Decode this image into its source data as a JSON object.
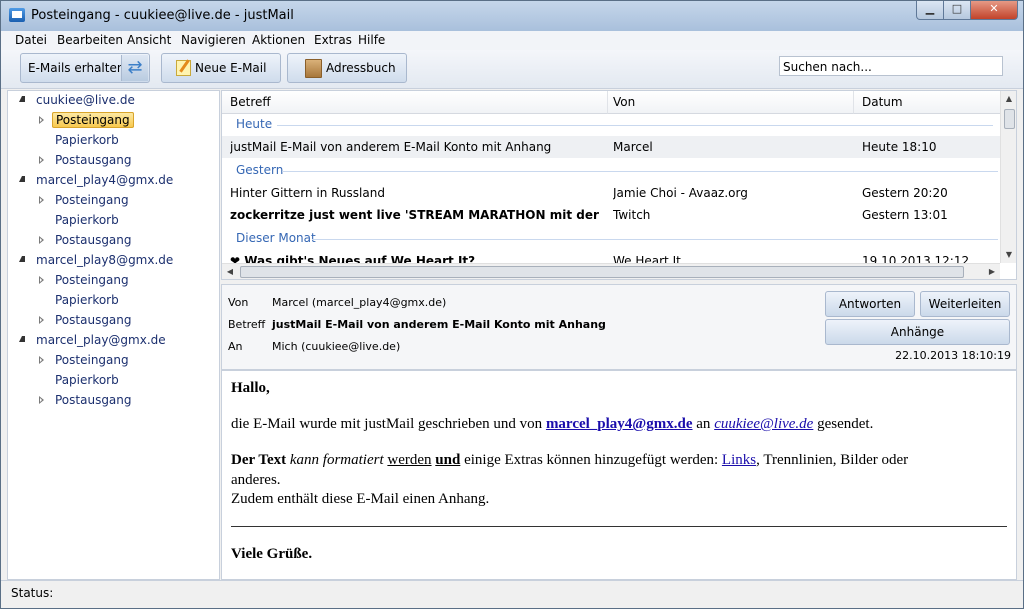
{
  "window": {
    "title": "Posteingang - cuukiee@live.de - justMail"
  },
  "menu": [
    "Datei",
    "Bearbeiten",
    "Ansicht",
    "Navigieren",
    "Aktionen",
    "Extras",
    "Hilfe"
  ],
  "toolbar": {
    "get_mail": "E-Mails erhalten",
    "new_mail": "Neue E-Mail",
    "addressbook": "Adressbuch",
    "search_placeholder": "Suchen nach..."
  },
  "tree": {
    "accounts": [
      {
        "name": "cuukiee@live.de",
        "folders": [
          "Posteingang",
          "Papierkorb",
          "Postausgang"
        ]
      },
      {
        "name": "marcel_play4@gmx.de",
        "folders": [
          "Posteingang",
          "Papierkorb",
          "Postausgang"
        ]
      },
      {
        "name": "marcel_play8@gmx.de",
        "folders": [
          "Posteingang",
          "Papierkorb",
          "Postausgang"
        ]
      },
      {
        "name": "marcel_play@gmx.de",
        "folders": [
          "Posteingang",
          "Papierkorb",
          "Postausgang"
        ]
      }
    ]
  },
  "list": {
    "headers": [
      "Betreff",
      "Von",
      "Datum"
    ],
    "groups": [
      "Heute",
      "Gestern",
      "Dieser Monat"
    ],
    "rows": [
      {
        "subject": "justMail E-Mail von anderem E-Mail Konto mit Anhang",
        "from": "Marcel",
        "date": "Heute 18:10"
      },
      {
        "subject": "Hinter Gittern in Russland",
        "from": "Jamie Choi - Avaaz.org",
        "date": "Gestern 20:20"
      },
      {
        "subject": "zockerritze just went live 'STREAM MARATHON mit der R...",
        "from": "Twitch",
        "date": "Gestern 13:01"
      },
      {
        "subject": "❤ Was gibt's Neues auf We Heart It?",
        "from": "We Heart It",
        "date": "19.10.2013 12:12"
      }
    ]
  },
  "preview": {
    "from_label": "Von",
    "from": "Marcel (marcel_play4@gmx.de)",
    "subject_label": "Betreff",
    "subject": "justMail E-Mail von anderem E-Mail Konto mit Anhang",
    "to_label": "An",
    "to": "Mich (cuukiee@live.de)",
    "date": "22.10.2013 18:10:19",
    "reply": "Antworten",
    "forward": "Weiterleiten",
    "attachments": "Anhänge"
  },
  "body": {
    "greeting": "Hallo,",
    "l1_a": "die E-Mail wurde mit justMail geschrieben und von ",
    "l1_link1": "marcel_play4@gmx.de",
    "l1_b": " an ",
    "l1_link2": "cuukiee@live.de",
    "l1_c": " gesendet.",
    "l2_bold": "Der Text",
    "l2_italic": "kann formatiert",
    "l2_under": "werden",
    "l2_boldunder": "und",
    "l2_rest": " einige Extras können hinzugefügt werden: ",
    "l2_link": "Links",
    "l2_end": ", Trennlinien, Bilder oder",
    "l3": "anderes.",
    "l4": "Zudem enthält diese E-Mail einen Anhang.",
    "closing": "Viele Grüße."
  },
  "status": {
    "label": "Status:"
  }
}
